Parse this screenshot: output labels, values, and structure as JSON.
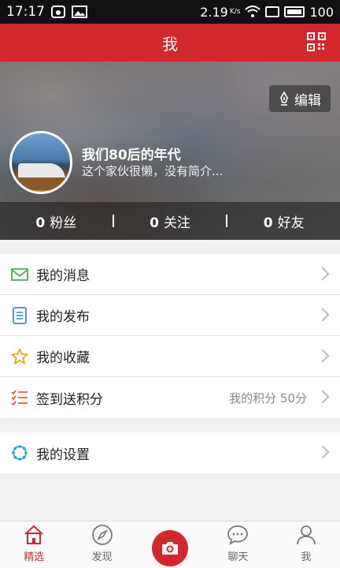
{
  "status_bar": {
    "time": "17:17",
    "speed": "2.19",
    "speed_unit": "K/s",
    "battery": "100"
  },
  "header": {
    "title": "我"
  },
  "profile": {
    "edit_label": "编辑",
    "username": "我们80后的年代",
    "bio": "这个家伙很懒，没有简介...",
    "stats": [
      {
        "count": "0",
        "label": "粉丝"
      },
      {
        "count": "0",
        "label": "关注"
      },
      {
        "count": "0",
        "label": "好友"
      }
    ]
  },
  "menu": [
    {
      "label": "我的消息",
      "icon": "mail-icon",
      "color": "#4caf50"
    },
    {
      "label": "我的发布",
      "icon": "document-icon",
      "color": "#3a8fd0"
    },
    {
      "label": "我的收藏",
      "icon": "star-icon",
      "color": "#e8a000"
    },
    {
      "label": "签到送积分",
      "icon": "checklist-icon",
      "color": "#e05020",
      "extra": "我的积分 50分"
    }
  ],
  "settings": {
    "label": "我的设置",
    "icon": "gear-icon",
    "color": "#2a9fd0"
  },
  "bottom_nav": [
    {
      "label": "精选",
      "icon": "home-icon"
    },
    {
      "label": "发现",
      "icon": "compass-icon"
    },
    {
      "label": "",
      "icon": "camera-icon"
    },
    {
      "label": "聊天",
      "icon": "chat-icon"
    },
    {
      "label": "我",
      "icon": "person-icon"
    }
  ],
  "colors": {
    "brand": "#d2282d"
  }
}
